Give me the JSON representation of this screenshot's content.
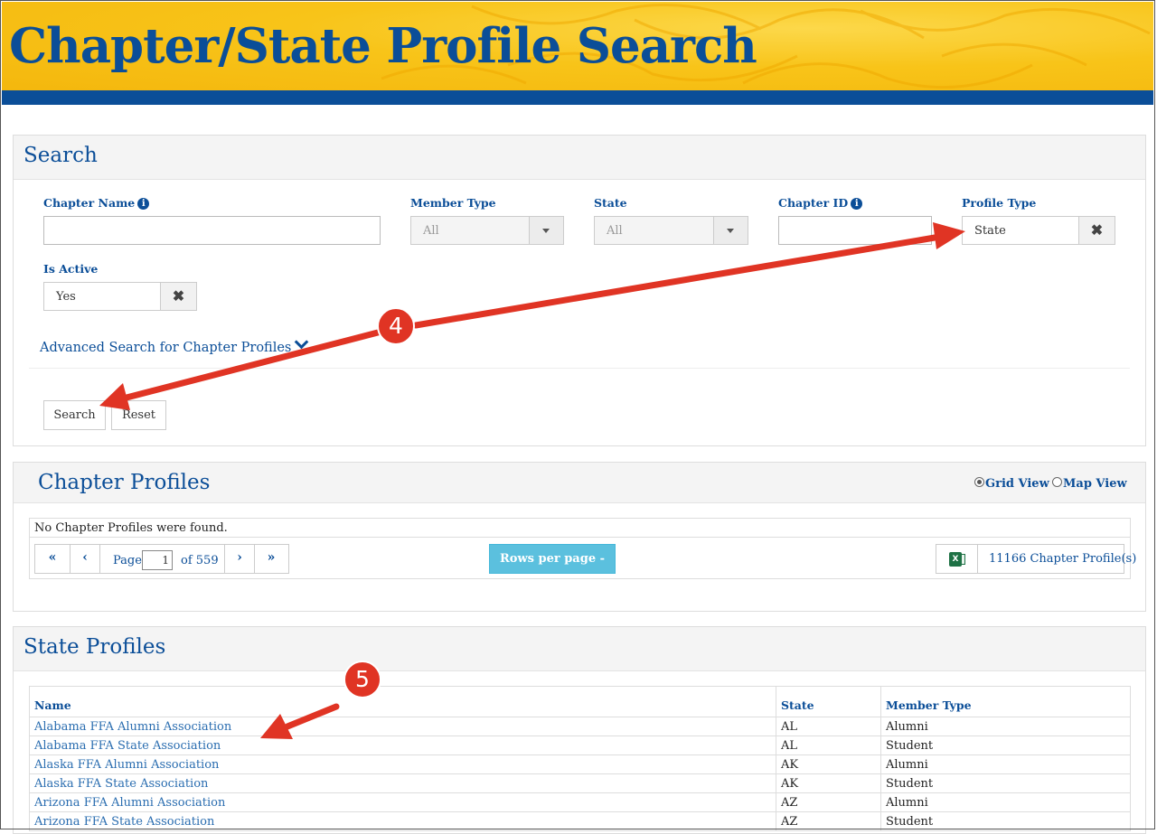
{
  "banner": {
    "title": "Chapter/State Profile Search"
  },
  "search_panel": {
    "title": "Search",
    "fields": {
      "chapter_name": {
        "label": "Chapter Name",
        "value": ""
      },
      "member_type": {
        "label": "Member Type",
        "value": "All"
      },
      "state": {
        "label": "State",
        "value": "All"
      },
      "chapter_id": {
        "label": "Chapter ID",
        "value": ""
      },
      "profile_type": {
        "label": "Profile Type",
        "value": "State"
      },
      "is_active": {
        "label": "Is Active",
        "value": "Yes"
      }
    },
    "advanced_link": "Advanced Search for Chapter Profiles",
    "search_button": "Search",
    "reset_button": "Reset"
  },
  "chapter_panel": {
    "title": "Chapter Profiles",
    "view_options": {
      "grid": "Grid View",
      "map": "Map View",
      "selected": "grid"
    },
    "empty_message": "No Chapter Profiles were found.",
    "pager": {
      "page_label": "Page",
      "current_page": "1",
      "of_label": "of 559"
    },
    "rows_per_page": "Rows per page - 20",
    "export_count": "11166 Chapter Profile(s)"
  },
  "state_panel": {
    "title": "State Profiles",
    "columns": [
      "Name",
      "State",
      "Member Type"
    ],
    "rows": [
      [
        "Alabama FFA Alumni Association",
        "AL",
        "Alumni"
      ],
      [
        "Alabama FFA State Association",
        "AL",
        "Student"
      ],
      [
        "Alaska FFA Alumni Association",
        "AK",
        "Alumni"
      ],
      [
        "Alaska FFA State Association",
        "AK",
        "Student"
      ],
      [
        "Arizona FFA Alumni Association",
        "AZ",
        "Alumni"
      ],
      [
        "Arizona FFA State Association",
        "AZ",
        "Student"
      ]
    ]
  },
  "annotations": {
    "step4": "4",
    "step5": "5",
    "arrow_color": "#e03424"
  },
  "colors": {
    "brand_blue": "#0b4e98",
    "banner_gold": "#f8c419",
    "info_button": "#5bc0de",
    "link": "#2a6db0"
  }
}
